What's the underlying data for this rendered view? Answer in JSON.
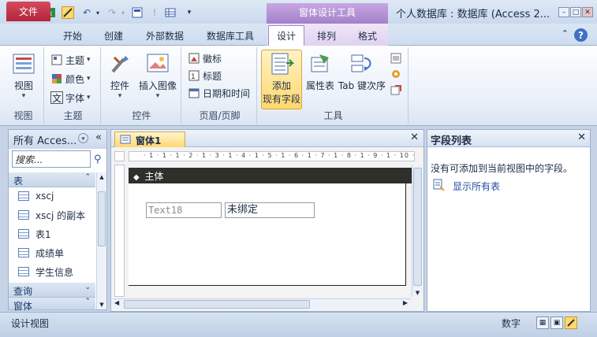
{
  "titlebar": {
    "app_icon": "A",
    "contextual_header": "窗体设计工具",
    "window_title": "个人数据库 : 数据库 (Access 2...",
    "quick_access": [
      "save-icon",
      "excel-icon",
      "design-view-icon",
      "undo-icon",
      "redo-icon",
      "form-icon",
      "info-icon",
      "table-icon",
      "customize-icon"
    ]
  },
  "tabs": {
    "file": "文件",
    "home": "开始",
    "create": "创建",
    "external": "外部数据",
    "dbtools": "数据库工具",
    "design": "设计",
    "arrange": "排列",
    "format": "格式"
  },
  "ribbon": {
    "views": {
      "view": "视图",
      "group": "视图"
    },
    "themes": {
      "theme": "主题",
      "colors": "颜色",
      "fonts": "字体",
      "group": "主题"
    },
    "controls": {
      "controls": "控件",
      "insert_image": "插入图像",
      "group": "控件"
    },
    "header_footer": {
      "logo": "徽标",
      "title": "标题",
      "date_time": "日期和时间",
      "group": "页眉/页脚"
    },
    "tools": {
      "add_fields_1": "添加",
      "add_fields_2": "现有字段",
      "property_sheet": "属性表",
      "tab_order": "Tab 键次序",
      "group": "工具"
    }
  },
  "nav": {
    "header": "所有 Acces...",
    "search_placeholder": "搜索...",
    "cat_tables": "表",
    "items": [
      "xscj",
      "xscj 的副本",
      "表1",
      "成绩单",
      "学生信息"
    ],
    "cat_queries": "查询",
    "cat_forms": "窗体"
  },
  "doc": {
    "tab_label": "窗体1",
    "ruler": "· 1 · 1 · 1 · 2 · 1 · 3 · 1 · 4 · 1 · 5 · 1 · 6 · 1 · 7 · 1 · 8 · 1 · 9 · 1 · 10 · 1",
    "section": "主体",
    "control_text": "Text18",
    "control_label": "未绑定"
  },
  "fieldlist": {
    "title": "字段列表",
    "message": "没有可添加到当前视图中的字段。",
    "show_all": "显示所有表"
  },
  "status": {
    "left": "设计视图",
    "right": "数字"
  },
  "colors": {
    "file_tab": "#b2253a",
    "contextual": "#a07ec8",
    "section_bar": "#2f2f2b",
    "highlight": "#ffd86d"
  }
}
